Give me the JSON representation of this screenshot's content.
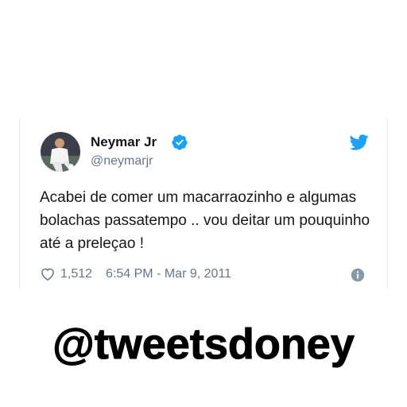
{
  "tweet": {
    "author": {
      "display_name": "Neymar Jr",
      "handle": "@neymarjr",
      "verified": true,
      "avatar_icon": "profile-photo"
    },
    "text": "Acabei de comer um macarraozinho e algumas bolachas passatempo .. vou deitar um pouquinho até a preleçao !",
    "likes": "1,512",
    "timestamp": "6:54 PM - Mar 9, 2011",
    "brand_icon": "twitter-bird-icon",
    "info_icon": "info-icon"
  },
  "watermark": {
    "text": "@tweetsdoney"
  },
  "colors": {
    "twitter_blue": "#1da1f2",
    "text_primary": "#14171a",
    "text_secondary": "#657786",
    "border": "#e6ecf0"
  }
}
